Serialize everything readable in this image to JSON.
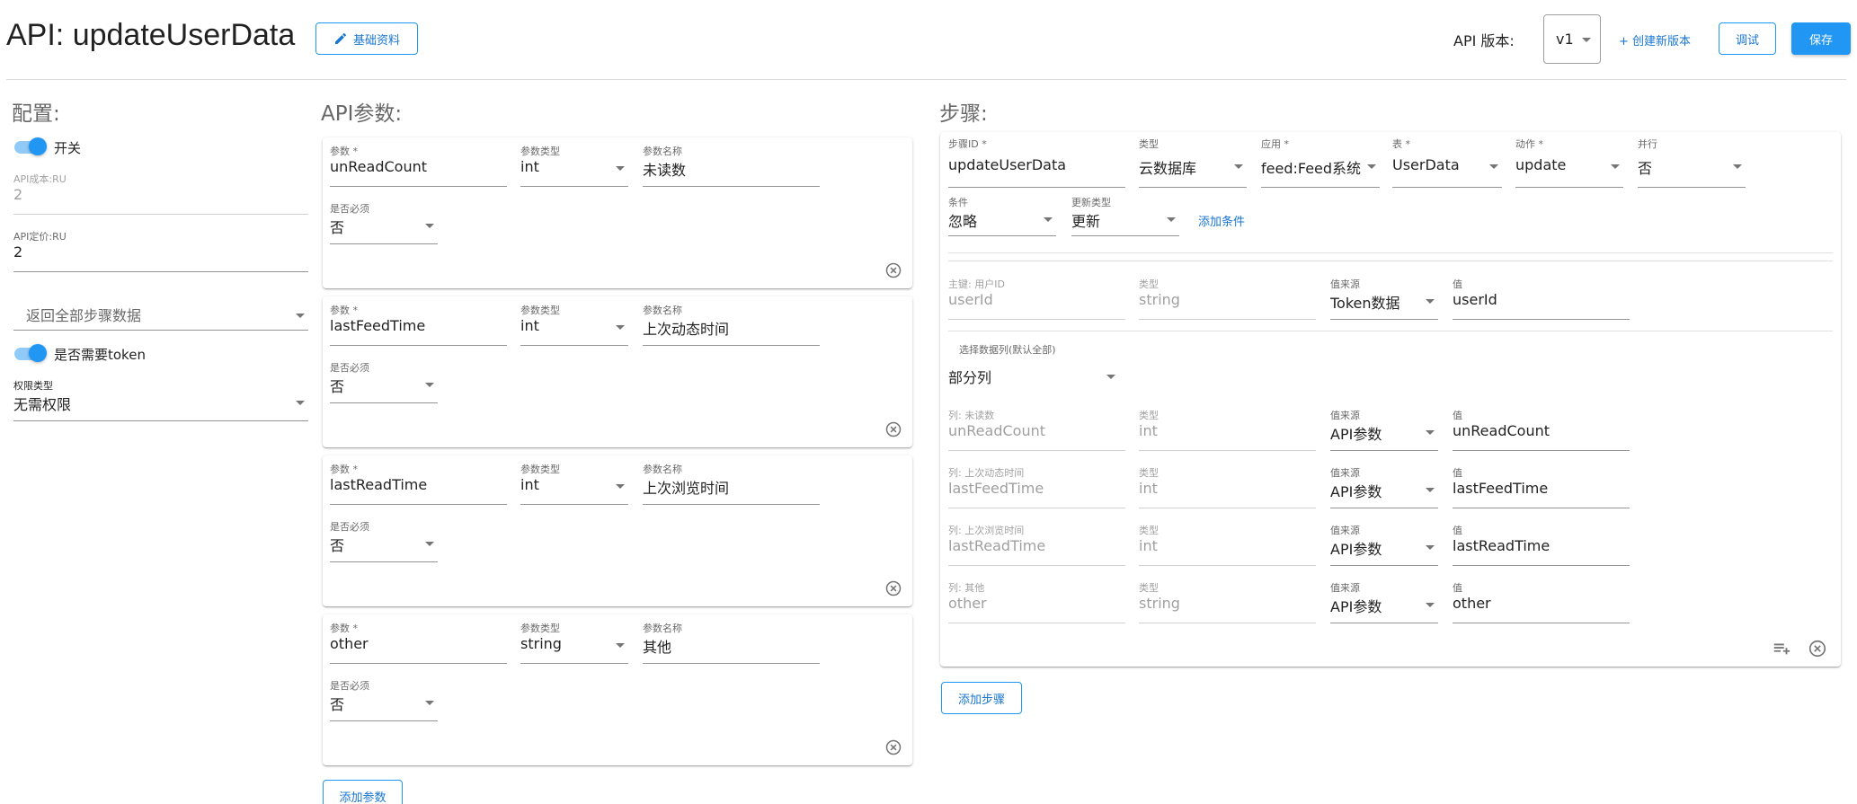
{
  "header": {
    "title": "API: updateUserData",
    "basic_info_label": "基础资料",
    "version_label": "API 版本:",
    "version_value": "v1",
    "create_version_label": "+ 创建新版本",
    "debug_label": "调试",
    "save_label": "保存"
  },
  "config": {
    "title": "配置:",
    "switch_label": "开关",
    "api_cost_label": "API成本:RU",
    "api_cost_value": "2",
    "api_price_label": "API定价:RU",
    "api_price_value": "2",
    "return_select": "返回全部步骤数据",
    "token_label": "是否需要token",
    "permission_label": "权限类型",
    "permission_value": "无需权限"
  },
  "params": {
    "title": "API参数:",
    "param_label": "参数 *",
    "type_label": "参数类型",
    "name_label": "参数名称",
    "required_label": "是否必须",
    "items": [
      {
        "param": "unReadCount",
        "type": "int",
        "name": "未读数",
        "required": "否"
      },
      {
        "param": "lastFeedTime",
        "type": "int",
        "name": "上次动态时间",
        "required": "否"
      },
      {
        "param": "lastReadTime",
        "type": "int",
        "name": "上次浏览时间",
        "required": "否"
      },
      {
        "param": "other",
        "type": "string",
        "name": "其他",
        "required": "否"
      }
    ],
    "add_label": "添加参数"
  },
  "steps": {
    "title": "步骤:",
    "step_id_label": "步骤ID *",
    "step_id_value": "updateUserData",
    "type_label": "类型",
    "type_value": "云数据库",
    "app_label": "应用 *",
    "app_value": "feed:Feed系统",
    "table_label": "表 *",
    "table_value": "UserData",
    "action_label": "动作 *",
    "action_value": "update",
    "parallel_label": "并行",
    "parallel_value": "否",
    "condition_label": "条件",
    "condition_value": "忽略",
    "update_type_label": "更新类型",
    "update_type_value": "更新",
    "add_condition_label": "添加条件",
    "key_row": {
      "key_label": "主键: 用户ID",
      "key_value": "userId",
      "type_label": "类型",
      "type_value": "string",
      "source_label": "值来源",
      "source_value": "Token数据",
      "value_label": "值",
      "value_value": "userId"
    },
    "columns_select_label": "选择数据列(默认全部)",
    "columns_select_value": "部分列",
    "columns": [
      {
        "col_label": "列: 未读数",
        "col": "unReadCount",
        "type_label": "类型",
        "type": "int",
        "source_label": "值来源",
        "source": "API参数",
        "value_label": "值",
        "value": "unReadCount"
      },
      {
        "col_label": "列: 上次动态时间",
        "col": "lastFeedTime",
        "type_label": "类型",
        "type": "int",
        "source_label": "值来源",
        "source": "API参数",
        "value_label": "值",
        "value": "lastFeedTime"
      },
      {
        "col_label": "列: 上次浏览时间",
        "col": "lastReadTime",
        "type_label": "类型",
        "type": "int",
        "source_label": "值来源",
        "source": "API参数",
        "value_label": "值",
        "value": "lastReadTime"
      },
      {
        "col_label": "列: 其他",
        "col": "other",
        "type_label": "类型",
        "type": "string",
        "source_label": "值来源",
        "source": "API参数",
        "value_label": "值",
        "value": "other"
      }
    ],
    "add_step_label": "添加步骤"
  },
  "colors": {
    "primary": "#2196f3",
    "primary_dark": "#1976d2"
  }
}
